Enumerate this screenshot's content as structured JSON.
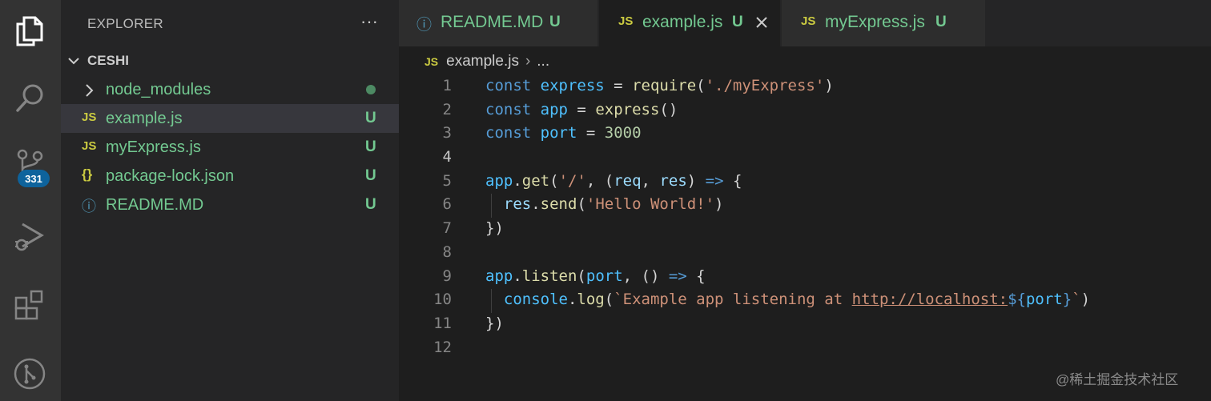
{
  "activity_bar": {
    "items": [
      "explorer-icon",
      "search-icon",
      "source-control-icon",
      "run-debug-icon",
      "extensions-icon",
      "git-graph-icon"
    ],
    "source_control_badge": "331"
  },
  "sidebar": {
    "title": "EXPLORER",
    "more_label": "···",
    "folder": "CESHI",
    "items": [
      {
        "icon": "›",
        "label": "node_modules",
        "status": ""
      },
      {
        "icon": "JS",
        "label": "example.js",
        "status": "U"
      },
      {
        "icon": "JS",
        "label": "myExpress.js",
        "status": "U"
      },
      {
        "icon": "{}",
        "label": "package-lock.json",
        "status": "U"
      },
      {
        "icon": "ⓘ",
        "label": "README.MD",
        "status": "U"
      }
    ]
  },
  "tabs": [
    {
      "icon": "ⓘ",
      "label": "README.MD",
      "status": "U",
      "active": false
    },
    {
      "icon": "JS",
      "label": "example.js",
      "status": "U",
      "active": true
    },
    {
      "icon": "JS",
      "label": "myExpress.js",
      "status": "U",
      "active": false
    }
  ],
  "breadcrumb": {
    "icon": "JS",
    "file": "example.js",
    "separator": "›",
    "more": "..."
  },
  "editor": {
    "line_numbers": [
      "1",
      "2",
      "3",
      "4",
      "5",
      "6",
      "7",
      "8",
      "9",
      "10",
      "11",
      "12"
    ],
    "current_line": "4",
    "lines": [
      "const express = require('./myExpress')",
      "const app = express()",
      "const port = 3000",
      "",
      "app.get('/', (req, res) => {",
      "  res.send('Hello World!')",
      "})",
      "",
      "app.listen(port, () => {",
      "  console.log(`Example app listening at http://localhost:${port}`)",
      "})",
      ""
    ]
  },
  "watermark": "@稀土掘金技术社区",
  "colors": {
    "activity_bg": "#333333",
    "sidebar_bg": "#252526",
    "editor_bg": "#1e1e1e",
    "untracked_green": "#73c991",
    "js_yellow": "#cbcb41",
    "badge_blue": "#0e639c"
  }
}
